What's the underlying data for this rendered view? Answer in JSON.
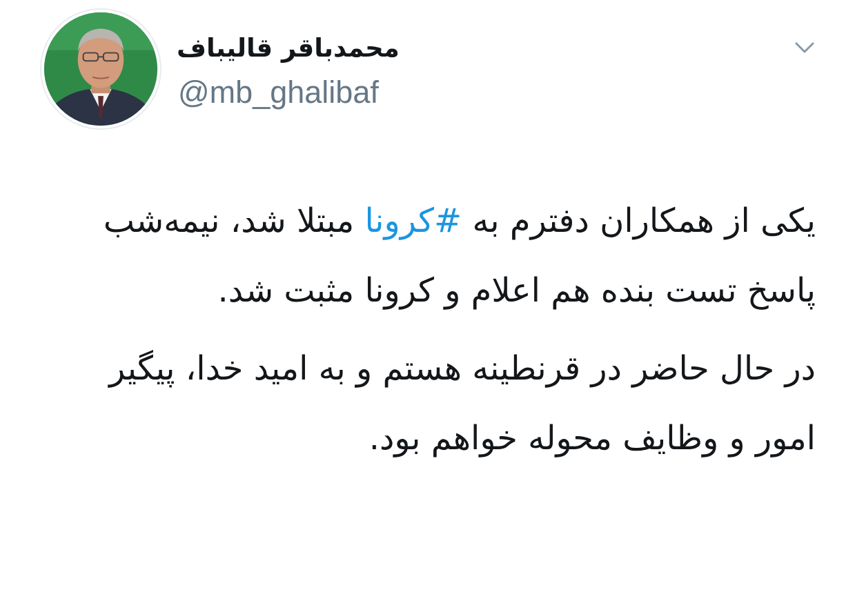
{
  "author": {
    "display_name": "محمدباقر قالیباف",
    "handle": "@mb_ghalibaf",
    "avatar_icon": "profile-photo"
  },
  "menu": {
    "icon": "chevron-down-icon"
  },
  "tweet": {
    "p1_before": "یکی از همکاران دفترم به ",
    "hashtag": "#کرونا",
    "p1_after": " مبتلا شد، نیمه‌شب پاسخ تست بنده هم اعلام و کرونا مثبت شد.",
    "p2": "در حال حاضر در قرنطینه هستم و به امید خدا، پیگیر امور و وظایف محوله خواهم بود."
  },
  "colors": {
    "link": "#1b95e0",
    "handle": "#657786",
    "text": "#14171a",
    "avatar_background": "#2f8a47"
  }
}
